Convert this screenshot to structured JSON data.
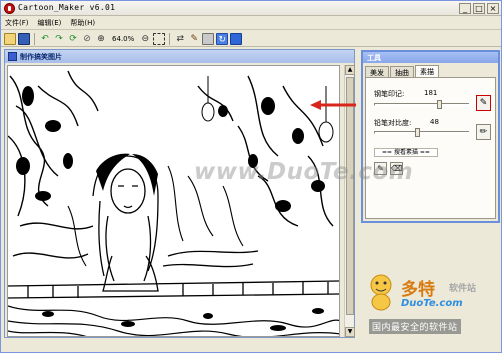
{
  "app": {
    "title": "Cartoon_Maker v6.01",
    "window_buttons": {
      "minimize": "_",
      "maximize": "□",
      "close": "×"
    }
  },
  "menu": [
    "文件(F)",
    "编辑(E)",
    "帮助(H)"
  ],
  "toolbar": {
    "zoom": "64.0%",
    "icons": [
      "open-folder-icon",
      "save-icon",
      "undo-icon",
      "redo-icon",
      "rotate-icon",
      "eraser-icon",
      "zoom-in-icon",
      "zoom-out-icon",
      "select-icon",
      "flip-icon",
      "brush-icon",
      "print-icon",
      "refresh-icon",
      "capture-icon"
    ]
  },
  "image_window": {
    "title": "制作搞笑图片"
  },
  "tool_panel": {
    "title": "工具",
    "tabs": [
      "美发",
      "抽曲",
      "素描"
    ],
    "active_tab": "素描",
    "pen_mark_label": "钢笔印记:",
    "pen_mark_value": "181",
    "pencil_contrast_label": "铅笔对比度:",
    "pencil_contrast_value": "48",
    "view_sketch_button": "== 搜看素描 ==",
    "pen_mark_level": 0.71,
    "pencil_contrast_level": 0.45
  },
  "watermark": {
    "text": "www.DuoTe.com",
    "brand_cn": "多特",
    "brand_suffix": "软件站",
    "brand_url": "DuoTe.com",
    "slogan": "国内最安全的软件站"
  },
  "colors": {
    "titlebar": "#ece9d8",
    "panel_border": "#6c8fdc",
    "arrow": "#d8261c",
    "brand_orange": "#d87b12",
    "brand_blue": "#2f8ee0"
  }
}
